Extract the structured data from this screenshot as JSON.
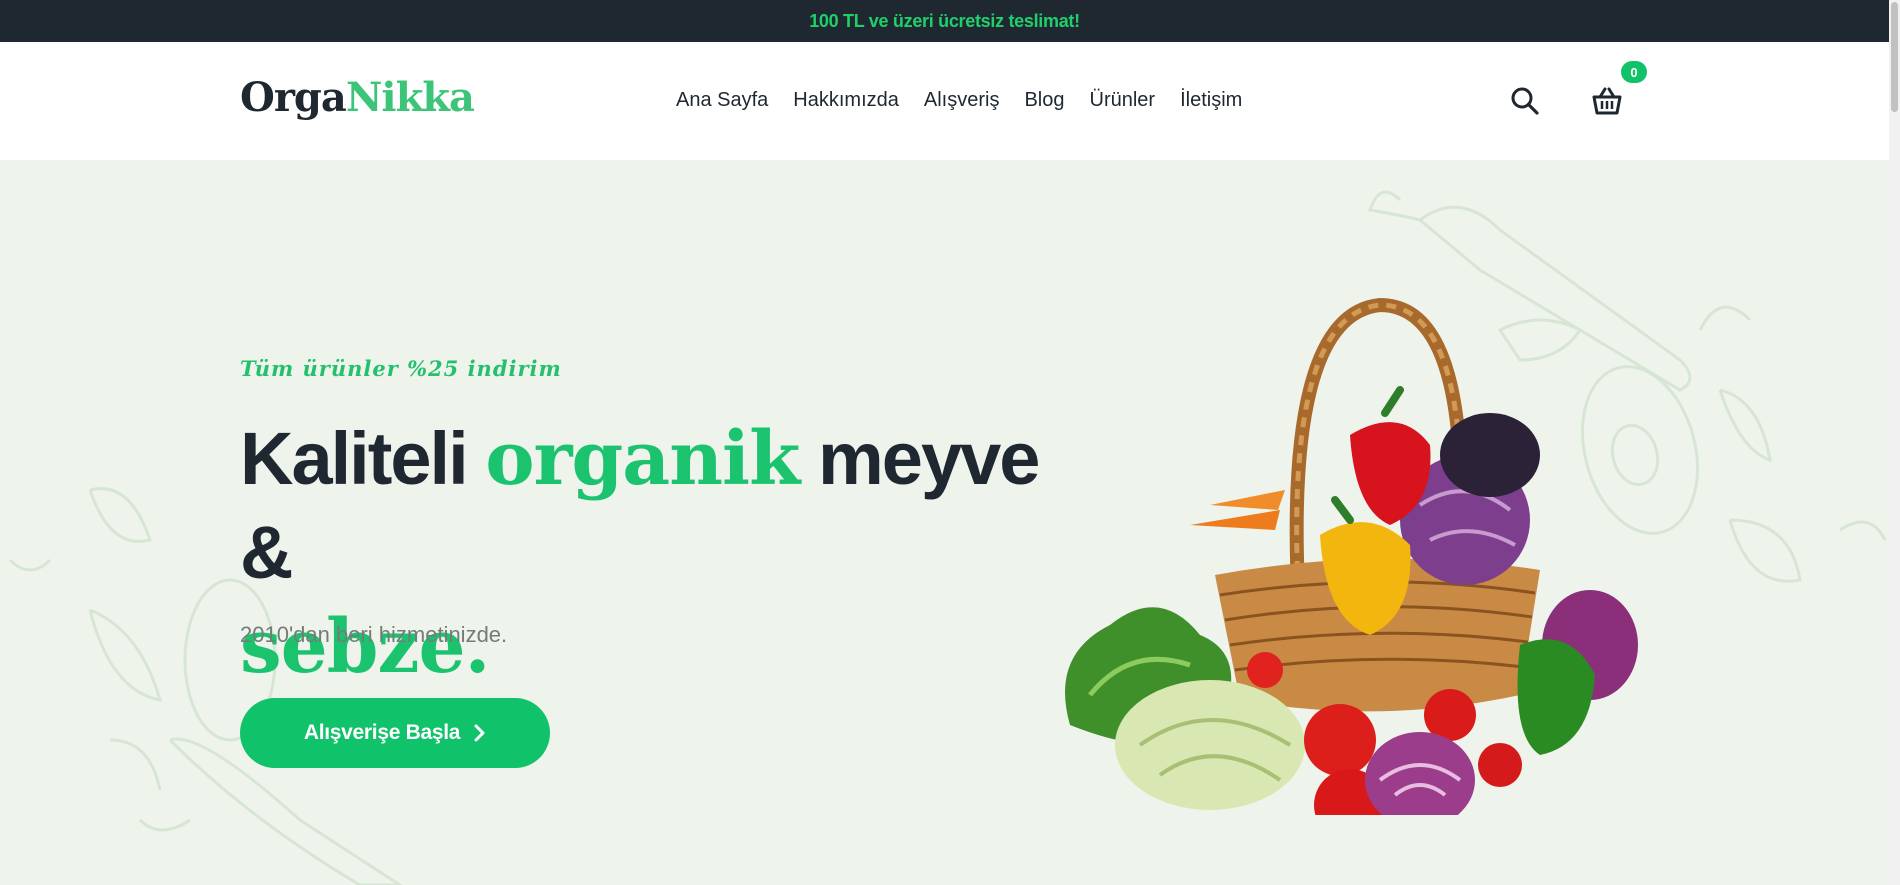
{
  "topbar": {
    "text": "100 TL ve üzeri ücretsiz teslimat!"
  },
  "header": {
    "logo_part1": "Orga",
    "logo_part2": "Nikka",
    "nav": [
      "Ana Sayfa",
      "Hakkımızda",
      "Alışveriş",
      "Blog",
      "Ürünler",
      "İletişim"
    ],
    "search_icon": "search-icon",
    "cart_icon": "basket-icon",
    "cart_count": "0"
  },
  "hero": {
    "promo": "Tüm ürünler %25 indirim",
    "headline_1": "Kaliteli ",
    "headline_green_1": "organik",
    "headline_2": " meyve &",
    "headline_green_2": "sebze.",
    "subtext": "2010'dan beri hizmetinizde.",
    "cta_label": "Alışverişe Başla",
    "cta_icon": "chevron-right-icon"
  },
  "colors": {
    "brand_green": "#10c26a",
    "dark": "#1f2731",
    "hero_bg": "#eef4ec"
  }
}
